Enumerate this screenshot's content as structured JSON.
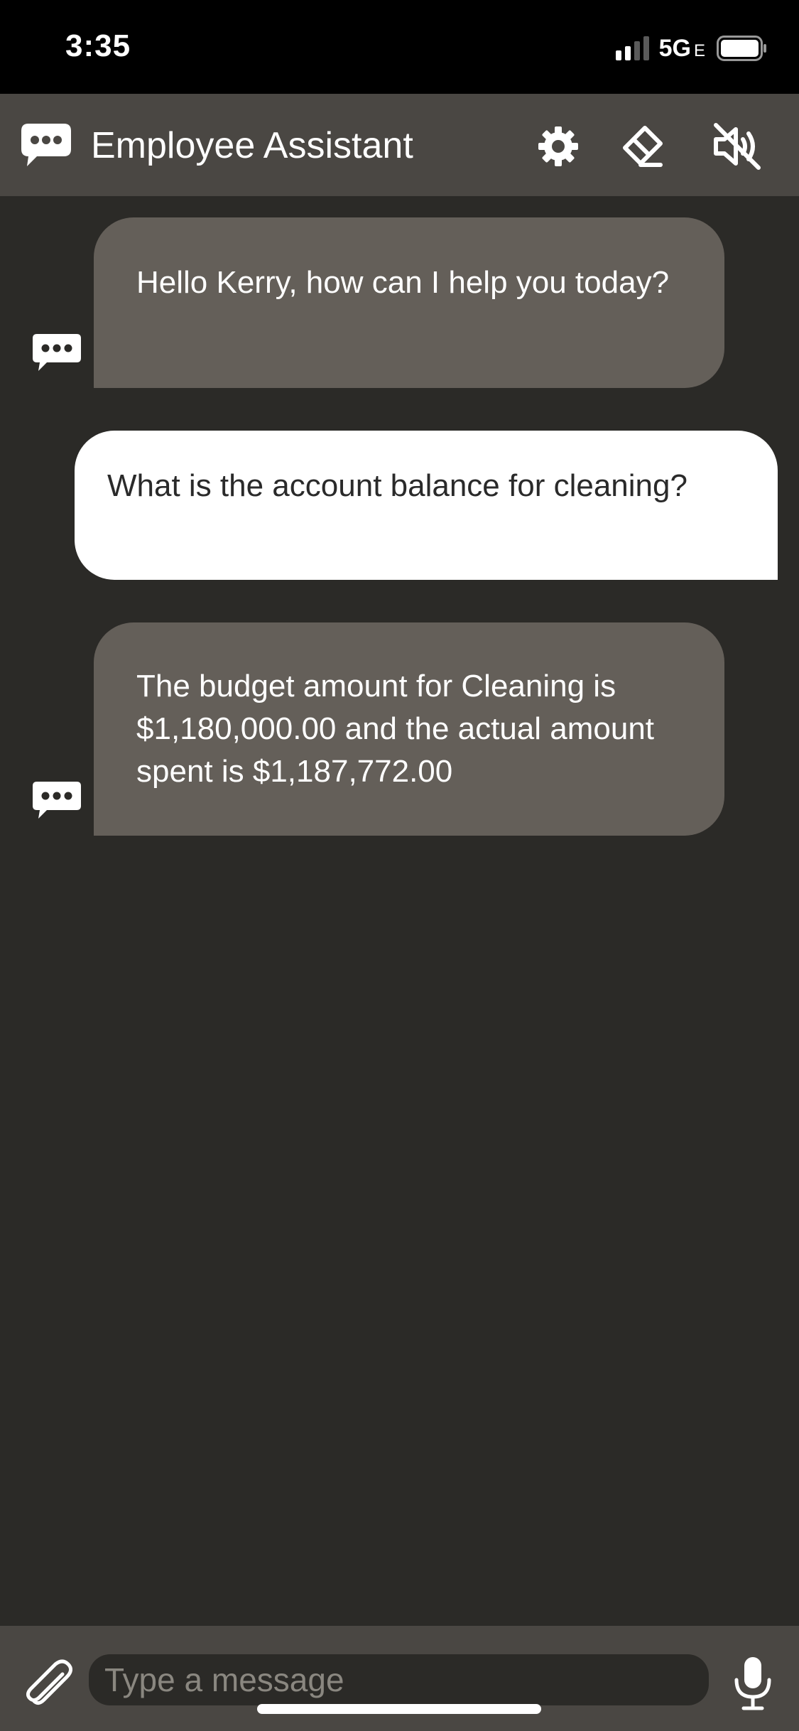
{
  "status_bar": {
    "time": "3:35",
    "network": "5G",
    "network_suffix": "E"
  },
  "header": {
    "title": "Employee Assistant",
    "icons": [
      "chat-bubble-icon",
      "gear-icon",
      "eraser-icon",
      "speaker-muted-icon"
    ]
  },
  "messages": [
    {
      "sender": "bot",
      "text": "Hello Kerry, how can I help you today?"
    },
    {
      "sender": "user",
      "text": "What is the account balance for cleaning?"
    },
    {
      "sender": "bot",
      "text": "The budget amount for Cleaning is $1,180,000.00 and the actual amount spent is $1,187,772.00"
    }
  ],
  "composer": {
    "placeholder": "Type a message",
    "icons": [
      "paperclip-icon",
      "microphone-icon"
    ]
  },
  "colors": {
    "background": "#2b2a27",
    "header": "#4a4743",
    "bot_bubble": "#645f59",
    "user_bubble": "#ffffff"
  }
}
